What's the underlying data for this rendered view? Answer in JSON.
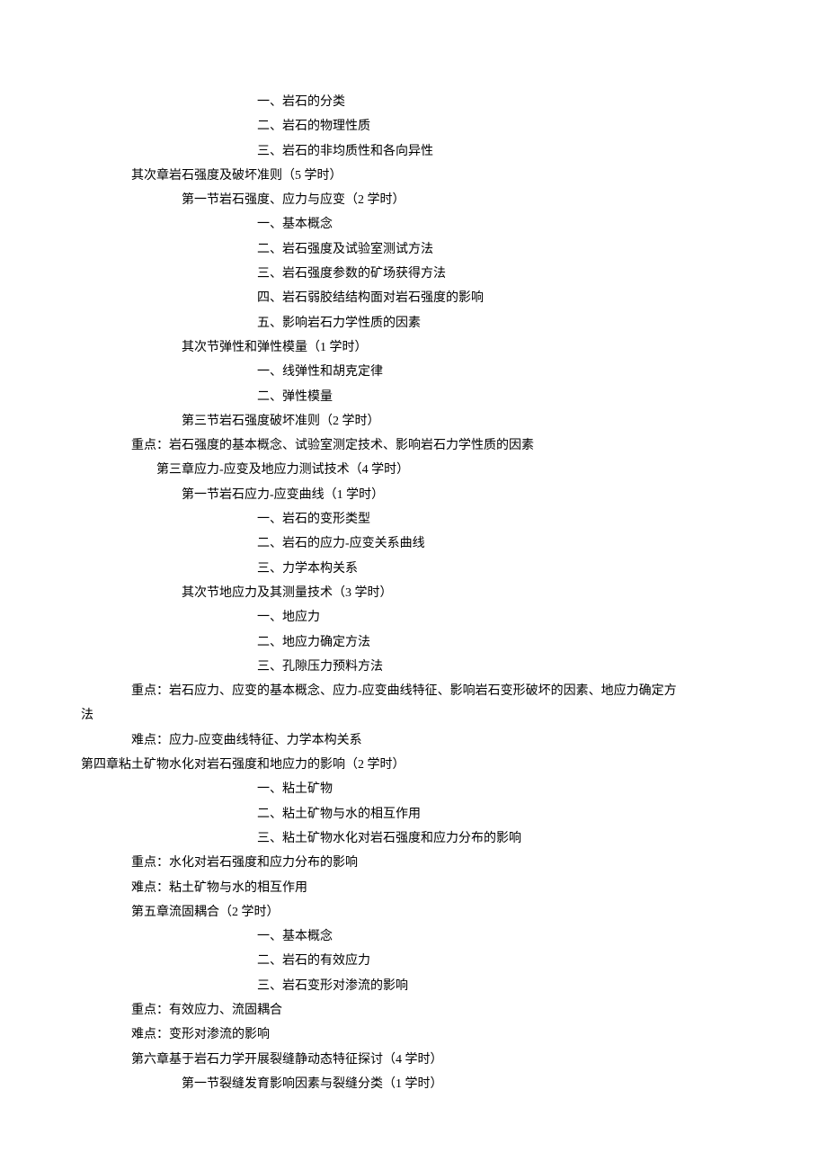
{
  "lines": [
    {
      "indent": 14,
      "text": "一、岩石的分类"
    },
    {
      "indent": 14,
      "text": "二、岩石的物理性质"
    },
    {
      "indent": 14,
      "text": "三、岩石的非均质性和各向异性"
    },
    {
      "indent": 4,
      "text": "其次章岩石强度及破坏准则（5 学时）"
    },
    {
      "indent": 8,
      "text": "第一节岩石强度、应力与应变（2 学时）"
    },
    {
      "indent": 14,
      "text": "一、基本概念"
    },
    {
      "indent": 14,
      "text": "二、岩石强度及试验室测试方法"
    },
    {
      "indent": 14,
      "text": "三、岩石强度参数的矿场获得方法"
    },
    {
      "indent": 14,
      "text": "四、岩石弱胶结结构面对岩石强度的影响"
    },
    {
      "indent": 14,
      "text": "五、影响岩石力学性质的因素"
    },
    {
      "indent": 8,
      "text": "其次节弹性和弹性模量（1 学时）"
    },
    {
      "indent": 14,
      "text": "一、线弹性和胡克定律"
    },
    {
      "indent": 14,
      "text": "二、弹性模量"
    },
    {
      "indent": 8,
      "text": "第三节岩石强度破坏准则（2 学时）"
    },
    {
      "indent": 4,
      "text": "重点：岩石强度的基本概念、试验室测定技术、影响岩石力学性质的因素"
    },
    {
      "indent": 6,
      "text": "第三章应力-应变及地应力测试技术（4 学时）"
    },
    {
      "indent": 8,
      "text": "第一节岩石应力-应变曲线（1 学时）"
    },
    {
      "indent": 14,
      "text": "一、岩石的变形类型"
    },
    {
      "indent": 14,
      "text": "二、岩石的应力-应变关系曲线"
    },
    {
      "indent": 14,
      "text": "三、力学本构关系"
    },
    {
      "indent": 8,
      "text": "其次节地应力及其测量技术（3 学时）"
    },
    {
      "indent": 14,
      "text": "一、地应力"
    },
    {
      "indent": 14,
      "text": "二、地应力确定方法"
    },
    {
      "indent": 14,
      "text": "三、孔隙压力预料方法"
    },
    {
      "indent": 4,
      "text": "重点：岩石应力、应变的基本概念、应力-应变曲线特征、影响岩石变形破坏的因素、地应力确定方"
    },
    {
      "indent": 0,
      "text": "法"
    },
    {
      "indent": 4,
      "text": "难点：应力-应变曲线特征、力学本构关系"
    },
    {
      "indent": 0,
      "text": "第四章粘土矿物水化对岩石强度和地应力的影响（2 学时）"
    },
    {
      "indent": 14,
      "text": "一、粘土矿物"
    },
    {
      "indent": 14,
      "text": "二、粘土矿物与水的相互作用"
    },
    {
      "indent": 14,
      "text": "三、粘土矿物水化对岩石强度和应力分布的影响"
    },
    {
      "indent": 4,
      "text": "重点：水化对岩石强度和应力分布的影响"
    },
    {
      "indent": 4,
      "text": "难点：粘土矿物与水的相互作用"
    },
    {
      "indent": 4,
      "text": "第五章流固耦合（2 学时）"
    },
    {
      "indent": 14,
      "text": "一、基本概念"
    },
    {
      "indent": 14,
      "text": "二、岩石的有效应力"
    },
    {
      "indent": 14,
      "text": "三、岩石变形对渗流的影响"
    },
    {
      "indent": 4,
      "text": "重点：有效应力、流固耦合"
    },
    {
      "indent": 4,
      "text": "难点：变形对渗流的影响"
    },
    {
      "indent": 4,
      "text": "第六章基于岩石力学开展裂缝静动态特征探讨（4 学时）"
    },
    {
      "indent": 8,
      "text": "第一节裂缝发育影响因素与裂缝分类（1 学时）"
    }
  ]
}
